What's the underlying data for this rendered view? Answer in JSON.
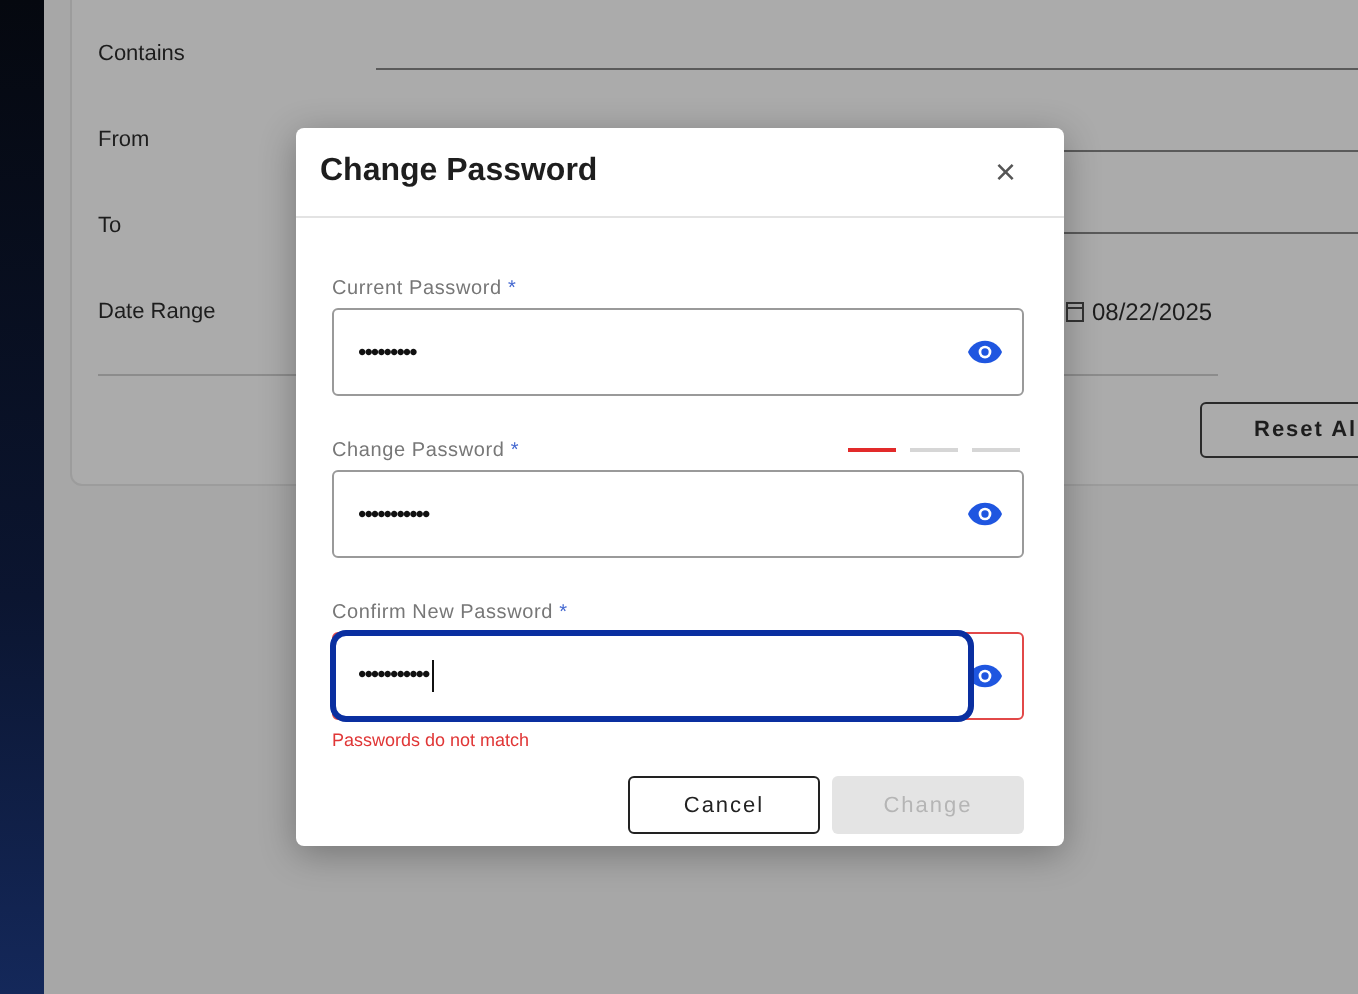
{
  "filters": {
    "rows": [
      {
        "label": "Contains",
        "kind": "line"
      },
      {
        "label": "From",
        "kind": "line"
      },
      {
        "label": "To",
        "kind": "line"
      },
      {
        "label": "Date Range",
        "kind": "date",
        "value": "08/22/2025"
      }
    ],
    "reset_button": "Reset Al"
  },
  "dialog": {
    "title": "Change Password",
    "close": "×",
    "fields": [
      {
        "label": "Current Password",
        "required": "*",
        "value": "•••••••••",
        "error": false,
        "focused": false
      },
      {
        "label": "Change Password",
        "required": "*",
        "value": "•••••••••••",
        "error": false,
        "focused": false,
        "strength": {
          "level": 0.3333
        }
      },
      {
        "label": "Confirm New Password",
        "required": "*",
        "value": "•••••••••••",
        "error": true,
        "focused": true,
        "message": "Passwords do not match"
      }
    ],
    "buttons": [
      {
        "label": "Cancel",
        "kind": "secondary",
        "disabled": false
      },
      {
        "label": "Change",
        "kind": "primary",
        "disabled": true
      }
    ]
  }
}
